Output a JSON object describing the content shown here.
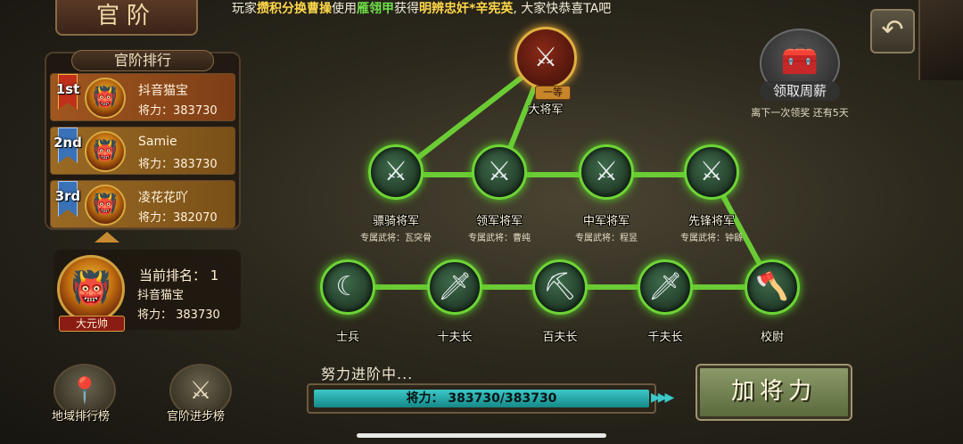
{
  "header": {
    "title": "官阶",
    "marquee": {
      "p1": "玩家",
      "player": "攒积分换曹操",
      "p2": "使用",
      "item": "雁翎甲",
      "p3": "获得",
      "reward": "明辨忠奸*辛宪英",
      "p4": ", 大家快恭喜TA吧"
    },
    "back_icon": "↶"
  },
  "ranking": {
    "title": "官阶排行",
    "entries": [
      {
        "badge": "1st",
        "name": "抖音猫宝",
        "power": "将力：383730",
        "avatar": "👹"
      },
      {
        "badge": "2nd",
        "name": "Samie",
        "power": "将力：383730",
        "avatar": "👹"
      },
      {
        "badge": "3rd",
        "name": "凌花花吖",
        "power": "将力：382070",
        "avatar": "👹"
      }
    ]
  },
  "current": {
    "label": "当前排名： 1",
    "name": "抖音猫宝",
    "power": "将力： 383730",
    "rank_badge": "大元帅",
    "avatar": "👹"
  },
  "bottom_buttons": {
    "region_label": "地域排行榜",
    "region_icon": "📍",
    "advance_label": "官阶进步榜",
    "advance_icon": "⚔"
  },
  "reward": {
    "label": "领取周薪",
    "sub": "离下一次领奖 还有5天",
    "icon": "🧰"
  },
  "tree": {
    "top": {
      "label": "大将军",
      "grade": "一等",
      "icon": "⚔"
    },
    "generals": [
      {
        "label": "骠骑将军",
        "sub": "专属武将：瓦突骨",
        "icon": "⚔"
      },
      {
        "label": "领军将军",
        "sub": "专属武将：曹纯",
        "icon": "⚔"
      },
      {
        "label": "中军将军",
        "sub": "专属武将：程昱",
        "icon": "⚔"
      },
      {
        "label": "先锋将军",
        "sub": "专属武将：钟繇",
        "icon": "⚔"
      }
    ],
    "ranks": [
      {
        "label": "士兵",
        "icon": "☾"
      },
      {
        "label": "十夫长",
        "icon": "🗡"
      },
      {
        "label": "百夫长",
        "icon": "⛏"
      },
      {
        "label": "千夫长",
        "icon": "🗡"
      },
      {
        "label": "校尉",
        "icon": "🪓"
      }
    ]
  },
  "progress": {
    "status": "努力进阶中...",
    "label": "将力： 383730/383730",
    "fill": 1.0,
    "arrows": "▶▶▶"
  },
  "actions": {
    "add_power": "加将力"
  },
  "colors": {
    "path_green": "#6ed436",
    "gold": "#e0b040",
    "progress": "#3cc8c8"
  }
}
